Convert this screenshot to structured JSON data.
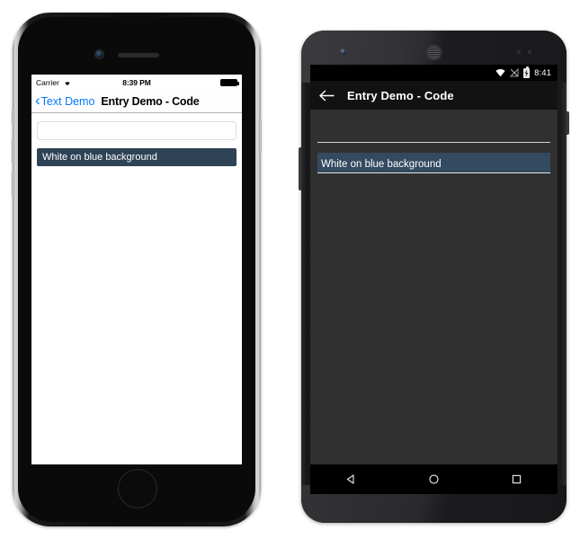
{
  "ios": {
    "status": {
      "carrier": "Carrier",
      "wifi_icon": "wifi-icon",
      "time": "8:39 PM",
      "battery_icon": "battery-full-icon"
    },
    "nav": {
      "back_icon": "chevron-left-icon",
      "back_label": "Text Demo",
      "title": "Entry Demo - Code"
    },
    "entries": [
      {
        "name": "plain-entry",
        "value": "",
        "placeholder": ""
      },
      {
        "name": "white-on-blue-entry",
        "value": "White on blue background",
        "placeholder": ""
      }
    ],
    "hardware": {
      "camera": "front-camera",
      "speaker": "earpiece-speaker",
      "home_button": "home-button",
      "silent_switch": "silent-switch",
      "volume_up": "volume-up-button",
      "volume_down": "volume-down-button",
      "power": "power-button"
    }
  },
  "android": {
    "status": {
      "wifi_icon": "wifi-icon",
      "signal_icon": "no-signal-icon",
      "battery_icon": "battery-charging-icon",
      "time": "8:41"
    },
    "actionbar": {
      "back_icon": "arrow-left-icon",
      "title": "Entry Demo - Code"
    },
    "entries": [
      {
        "name": "plain-entry",
        "value": "",
        "placeholder": ""
      },
      {
        "name": "white-on-blue-entry",
        "value": "White on blue background",
        "placeholder": ""
      }
    ],
    "navbar": {
      "back": "back-triangle-icon",
      "home": "home-circle-icon",
      "recents": "recents-square-icon"
    },
    "hardware": {
      "camera": "front-camera",
      "speaker": "earpiece-speaker",
      "power": "power-button",
      "volume": "volume-rocker"
    }
  },
  "colors": {
    "ios_accent": "#007aff",
    "entry_blue_ios": "#2f4357",
    "entry_blue_android": "#334a60",
    "android_bg": "#303030",
    "android_actionbar": "#121212"
  }
}
